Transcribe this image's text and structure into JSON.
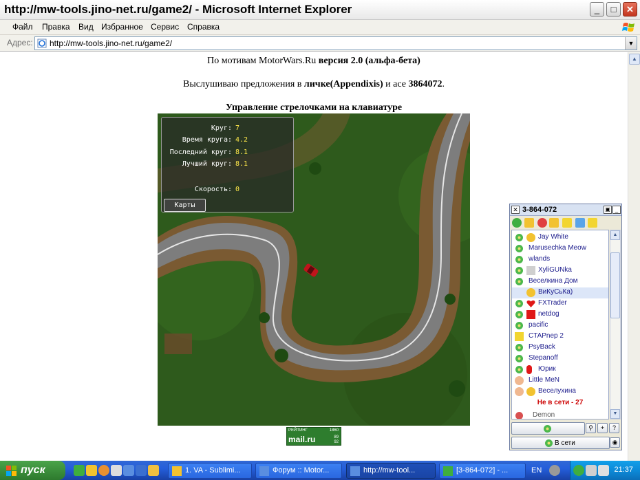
{
  "window": {
    "title": "http://mw-tools.jino-net.ru/game2/ - Microsoft Internet Explorer",
    "buttons": {
      "minimize": "_",
      "maximize": "□",
      "close": "✕"
    }
  },
  "menu": [
    "Файл",
    "Правка",
    "Вид",
    "Избранное",
    "Сервис",
    "Справка"
  ],
  "address": {
    "label": "Адрес:",
    "url": "http://mw-tools.jino-net.ru/game2/"
  },
  "page": {
    "line1_prefix": "По мотивам MotorWars.Ru ",
    "line1_bold": "версия 2.0 (альфа-бета)",
    "line2_prefix": "Выслушиваю предложения в ",
    "line2_bold1": "личке(Appendixis)",
    "line2_mid": " и асе ",
    "line2_bold2": "3864072",
    "line2_end": ".",
    "line3": "Управление стрелочками на клавиатуре"
  },
  "hud": {
    "lap_label": "Круг:",
    "lap_value": "7",
    "laptime_label": "Время круга:",
    "laptime_value": "4.2",
    "last_label": "Последний круг:",
    "last_value": "8.1",
    "best_label": "Лучший круг:",
    "best_value": "8.1",
    "speed_label": "Скорость:",
    "speed_value": "0",
    "maps_button": "Карты"
  },
  "rating": {
    "label": "РЕЙТИНГ",
    "top": "1860",
    "logo": "mail.ru",
    "n1": "89",
    "n2": "92"
  },
  "icq": {
    "title": "3-864-072",
    "contacts": [
      {
        "name": "Jay White",
        "status": "online"
      },
      {
        "name": "Marusechka Meow",
        "status": "online"
      },
      {
        "name": "wlands",
        "status": "online"
      },
      {
        "name": "XyliGUNka",
        "status": "online"
      },
      {
        "name": "Веселкина Дом",
        "status": "online"
      },
      {
        "name": "ВиКуСьКа)",
        "status": "online"
      },
      {
        "name": "FXTrader",
        "status": "online"
      },
      {
        "name": "netdog",
        "status": "online"
      },
      {
        "name": "pacific",
        "status": "online"
      },
      {
        "name": "CTAPnep 2",
        "status": "online"
      },
      {
        "name": "PsyBack",
        "status": "online"
      },
      {
        "name": "Stepanoff",
        "status": "online"
      },
      {
        "name": "Юрик",
        "status": "online"
      },
      {
        "name": "Little MeN",
        "status": "online"
      },
      {
        "name": "Веселухина",
        "status": "online"
      }
    ],
    "offline_header": "Не в сети - 27",
    "offline_first": "Demon",
    "status_label": "В сети"
  },
  "taskbar": {
    "start": "пуск",
    "tasks": [
      "1. VA - Sublimi...",
      "Форум :: Motor...",
      "http://mw-tool...",
      "[3-864-072] - ..."
    ],
    "lang": "EN",
    "clock": "21:37"
  }
}
